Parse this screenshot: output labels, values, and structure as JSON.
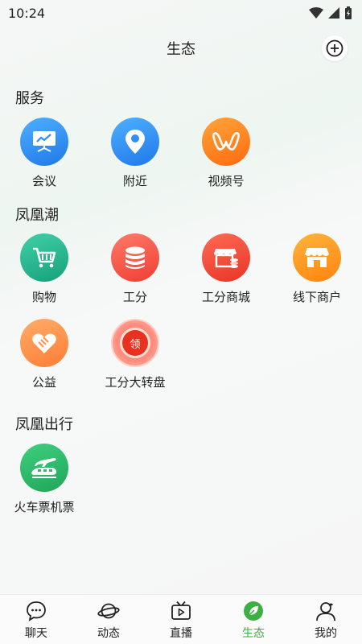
{
  "status": {
    "time": "10:24"
  },
  "header": {
    "title": "生态"
  },
  "sections": {
    "services": {
      "title": "服务",
      "items": [
        {
          "label": "会议",
          "color": "#2f8ff2"
        },
        {
          "label": "附近",
          "color": "#2f8ff2"
        },
        {
          "label": "视频号",
          "color": "#ff7a1a"
        }
      ]
    },
    "phoenix_tide": {
      "title": "凤凰潮",
      "items": [
        {
          "label": "购物",
          "color": "#27b88f"
        },
        {
          "label": "工分",
          "color": "#f25a4a"
        },
        {
          "label": "工分商城",
          "color": "#f04b3a"
        },
        {
          "label": "线下商户",
          "color": "#ff9a1a"
        },
        {
          "label": "公益",
          "color": "#ff9148"
        },
        {
          "label": "工分大转盘",
          "color": "#f25a4a",
          "badge": "领"
        }
      ]
    },
    "phoenix_travel": {
      "title": "凤凰出行",
      "items": [
        {
          "label": "火车票机票",
          "color": "#2eb86a"
        }
      ]
    }
  },
  "tabs": [
    {
      "label": "聊天",
      "icon": "chat-bubble-icon"
    },
    {
      "label": "动态",
      "icon": "planet-icon"
    },
    {
      "label": "直播",
      "icon": "tv-icon"
    },
    {
      "label": "生态",
      "icon": "leaf-icon",
      "active": true
    },
    {
      "label": "我的",
      "icon": "profile-icon"
    }
  ],
  "colors": {
    "active_tab": "#3cb043"
  }
}
